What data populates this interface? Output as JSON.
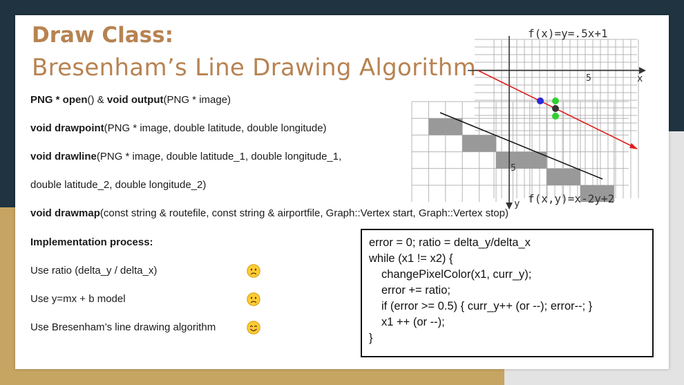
{
  "slide": {
    "title_bold": "Draw Class:",
    "title_sub": "Bresenham’s Line Drawing Algorithm"
  },
  "functions": [
    {
      "bold1": "PNG * open",
      "plain1": "() & ",
      "bold2": "void output",
      "plain2": "(PNG * image)"
    },
    {
      "bold1": "void drawpoint",
      "plain1": "(PNG * image, double latitude, double longitude)"
    },
    {
      "bold1": "void drawline",
      "plain1": "(PNG * image, double latitude_1, double longitude_1,"
    },
    {
      "plain1": "double latitude_2, double longitude_2)"
    },
    {
      "bold1": "void drawmap",
      "plain1": "(const string & routefile, const string & airportfile, Graph::Vertex start, Graph::Vertex stop)"
    }
  ],
  "implementation": {
    "heading": "Implementation process:",
    "steps": [
      {
        "label": "Use ratio (delta_y / delta_x)",
        "emoji": "worried-face-icon"
      },
      {
        "label": "Use y=mx + b model",
        "emoji": "worried-face-icon"
      },
      {
        "label": "Use Bresenham’s line drawing algorithm",
        "emoji": "smiling-face-icon"
      }
    ]
  },
  "code": [
    "error = 0; ratio = delta_y/delta_x",
    "while (x1 != x2) {",
    "    changePixelColor(x1, curr_y);",
    "    error += ratio;",
    "    if (error >= 0.5) { curr_y++ (or --);  error--; }",
    "    x1 ++ (or --);",
    "}"
  ],
  "figure": {
    "top_formula": "f(x)=y=.5x+1",
    "bottom_formula": "f(x,y)=x-2y+2",
    "x_axis_label": "x",
    "y_axis_label": "y",
    "tick_top": "5",
    "tick_bottom": "5",
    "colors": {
      "red_line": "#e01a1a",
      "blue_point": "#2a2ad6",
      "green_point": "#2ed12e",
      "filled_cell": "#999999"
    }
  }
}
